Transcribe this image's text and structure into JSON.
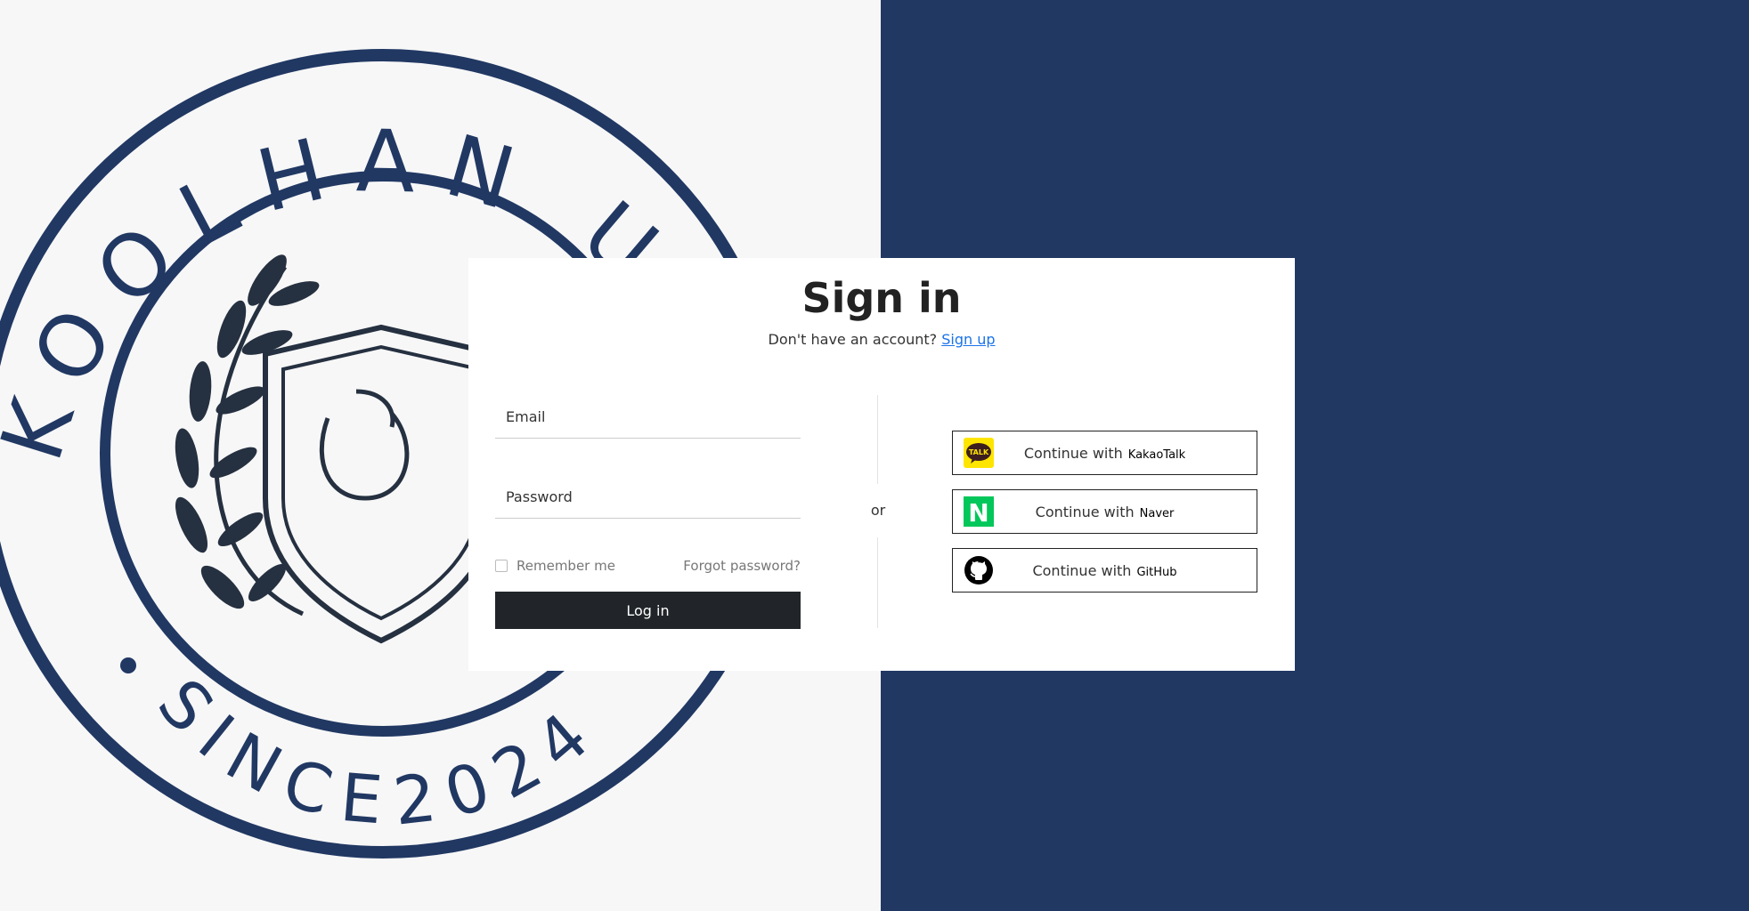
{
  "background": {
    "left_color": "#f7f7f7",
    "right_color": "#213863",
    "seal": {
      "top_text": "KOOLHAN UNIVERSITY",
      "bottom_text": "SINCE2024",
      "color": "#213863"
    }
  },
  "signin": {
    "title": "Sign in",
    "no_account_text": "Don't have an account?",
    "signup_link": "Sign up",
    "email_placeholder": "Email",
    "password_placeholder": "Password",
    "remember_label": "Remember me",
    "forgot_link": "Forgot password?",
    "login_button": "Log in",
    "or_text": "or"
  },
  "social": [
    {
      "prefix": "Continue with",
      "brand": "KakaoTalk",
      "icon": "kakaotalk-icon",
      "icon_text": "TALK",
      "color": "#FEE500"
    },
    {
      "prefix": "Continue with",
      "brand": "Naver",
      "icon": "naver-icon",
      "icon_text": "N",
      "color": "#03C75A"
    },
    {
      "prefix": "Continue with",
      "brand": "GitHub",
      "icon": "github-icon",
      "color": "#000000"
    }
  ]
}
